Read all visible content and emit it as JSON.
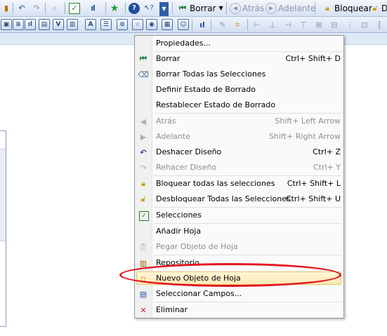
{
  "toolbar1": {
    "borrar_label": "Borrar",
    "atras_label": "Atrás",
    "adelante_label": "Adelante",
    "bloquear_label": "Bloquear",
    "cut_label": "D"
  },
  "menu": {
    "items": [
      {
        "label": "Propiedades...",
        "shortcut": "",
        "icon": "none",
        "disabled": false
      },
      {
        "label": "Borrar",
        "shortcut": "Ctrl+ Shift+ D",
        "icon": "borrar-icon",
        "disabled": false
      },
      {
        "label": "Borrar Todas las Selecciones",
        "shortcut": "",
        "icon": "eraser-icon",
        "disabled": false
      },
      {
        "label": "Definir Estado de Borrado",
        "shortcut": "",
        "icon": "none",
        "disabled": false
      },
      {
        "label": "Restablecer Estado de Borrado",
        "shortcut": "",
        "icon": "none",
        "disabled": false
      },
      {
        "label": "Atrás",
        "shortcut": "Shift+ Left Arrow",
        "icon": "back-icon",
        "disabled": true
      },
      {
        "label": "Adelante",
        "shortcut": "Shift+ Right Arrow",
        "icon": "forward-icon",
        "disabled": true
      },
      {
        "label": "Deshacer Diseño",
        "shortcut": "Ctrl+ Z",
        "icon": "undo-icon",
        "disabled": false
      },
      {
        "label": "Rehacer Diseño",
        "shortcut": "Ctrl+ Y",
        "icon": "redo-icon",
        "disabled": true
      },
      {
        "label": "Bloquear todas las selecciones",
        "shortcut": "Ctrl+ Shift+ L",
        "icon": "lock-icon",
        "disabled": false
      },
      {
        "label": "Desbloquear Todas las Selecciones",
        "shortcut": "Ctrl+ Shift+ U",
        "icon": "unlock-icon",
        "disabled": false
      },
      {
        "label": "Selecciones",
        "shortcut": "",
        "icon": "selections-icon",
        "disabled": false
      },
      {
        "label": "Añadir Hoja",
        "shortcut": "",
        "icon": "none",
        "disabled": false
      },
      {
        "label": "Pegar Objeto de Hoja",
        "shortcut": "",
        "icon": "paste-icon",
        "disabled": true
      },
      {
        "label": "Repositorio",
        "shortcut": "",
        "icon": "repository-icon",
        "disabled": false
      },
      {
        "label": "Nuevo Objeto de Hoja",
        "shortcut": "",
        "icon": "new-object-icon",
        "disabled": false,
        "highlighted": true
      },
      {
        "label": "Seleccionar Campos...",
        "shortcut": "",
        "icon": "select-fields-icon",
        "disabled": false
      },
      {
        "label": "Eliminar",
        "shortcut": "",
        "icon": "delete-icon",
        "disabled": false
      }
    ]
  },
  "colors": {
    "highlight": "#fde9b4",
    "annotation_circle": "#e2161f",
    "toolbar": "#d6e2f3"
  }
}
